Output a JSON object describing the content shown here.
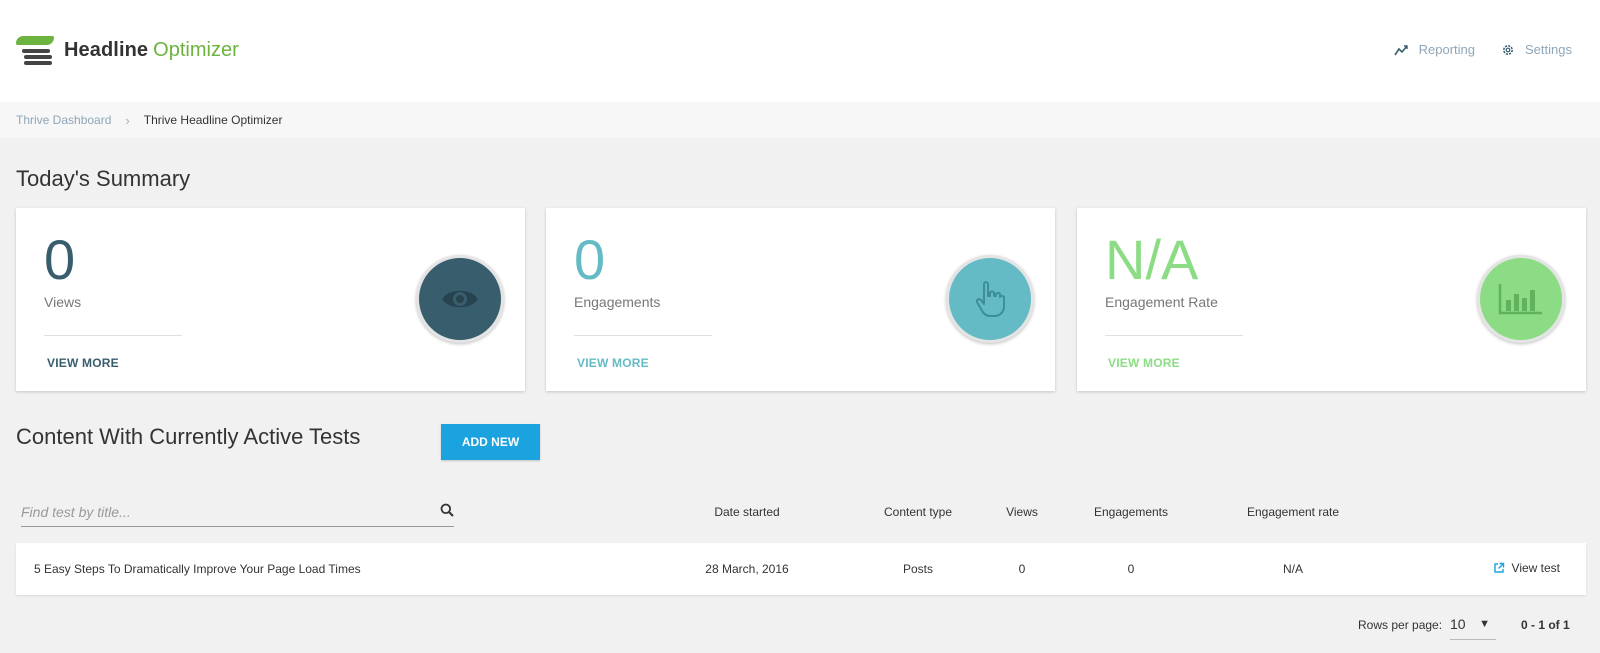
{
  "header": {
    "app_name": "Headline",
    "app_name_accent": "Optimizer",
    "nav": [
      {
        "label": "Reporting",
        "icon": "chart-line-icon"
      },
      {
        "label": "Settings",
        "icon": "gear-icon"
      }
    ]
  },
  "breadcrumb": {
    "parent": "Thrive Dashboard",
    "separator": "›",
    "current": "Thrive Headline Optimizer"
  },
  "summary": {
    "title": "Today's Summary",
    "cards": [
      {
        "value": "0",
        "label": "Views",
        "more": "VIEW MORE",
        "icon": "eye-icon",
        "color": "#385e6d"
      },
      {
        "value": "0",
        "label": "Engagements",
        "more": "VIEW MORE",
        "icon": "pointer-hand-icon",
        "color": "#64bbc5"
      },
      {
        "value": "N/A",
        "label": "Engagement Rate",
        "more": "VIEW MORE",
        "icon": "bar-chart-icon",
        "color": "#8bdc84"
      }
    ]
  },
  "tests": {
    "title": "Content With Currently Active Tests",
    "add_new": "ADD NEW",
    "search_placeholder": "Find test by title...",
    "columns": [
      "Date started",
      "Content type",
      "Views",
      "Engagements",
      "Engagement rate"
    ],
    "rows": [
      {
        "title": "5 Easy Steps To Dramatically Improve Your Page Load Times",
        "date_started": "28 March, 2016",
        "content_type": "Posts",
        "views": "0",
        "engagements": "0",
        "engagement_rate": "N/A",
        "action": "View test"
      }
    ],
    "pager": {
      "rows_per_page_label": "Rows per page:",
      "rows_per_page": "10",
      "range": "0 - 1 of 1"
    }
  },
  "colors": {
    "accent_green": "#6cb33f",
    "button_blue": "#1ba3e0",
    "link_muted": "#8fa6b8"
  }
}
